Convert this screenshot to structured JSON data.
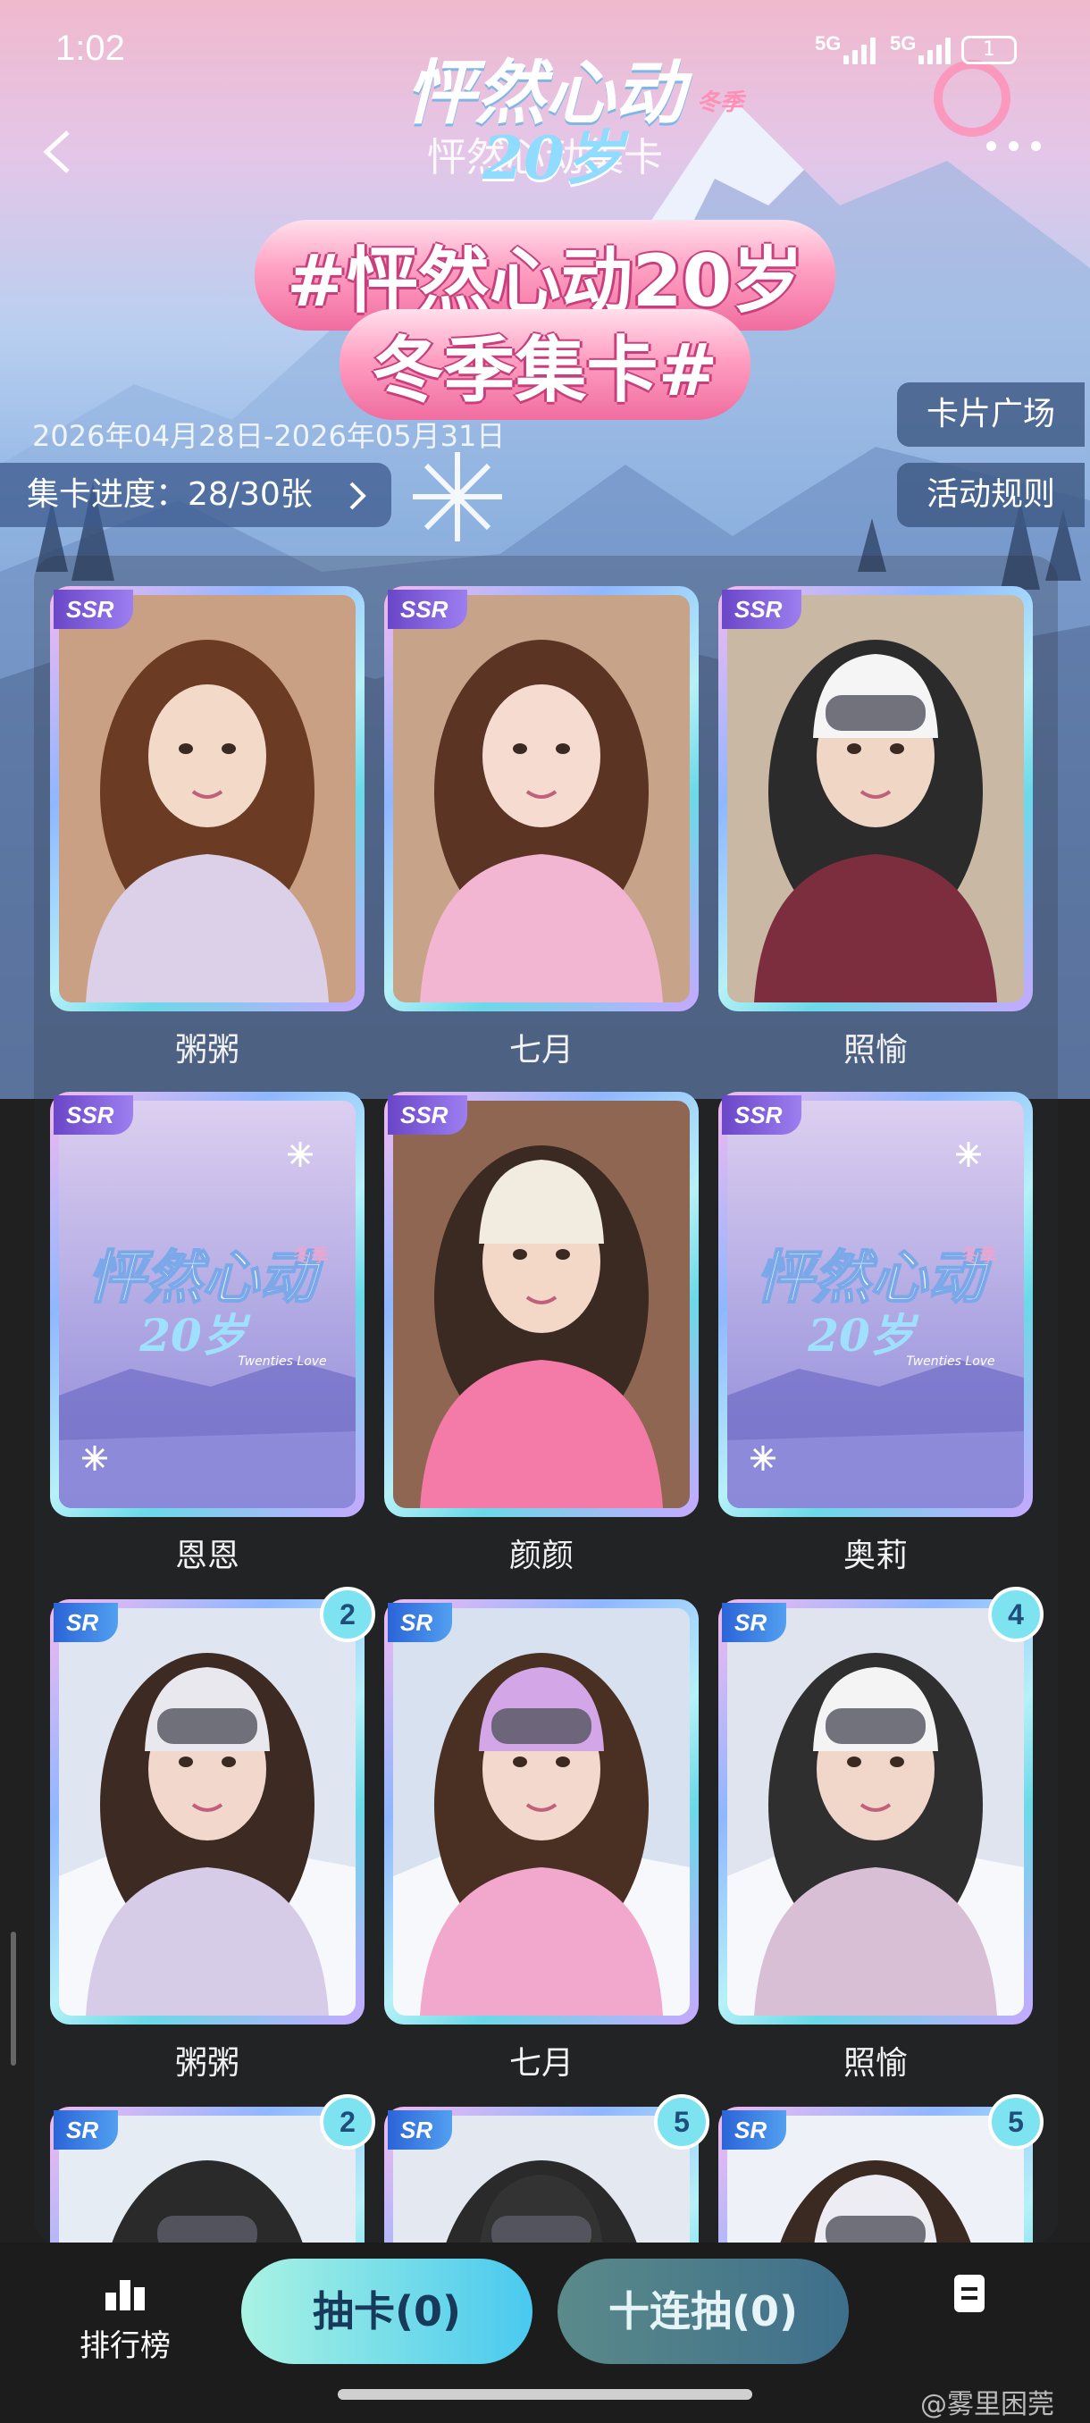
{
  "status_bar": {
    "time": "1:02",
    "signal_1": "5G",
    "signal_2": "5G",
    "battery": "1"
  },
  "header": {
    "title": "怦然心动集卡",
    "logo_main": "怦然心动",
    "logo_sub": "20岁",
    "logo_tag": "冬季"
  },
  "banner": {
    "line1": "#怦然心动20岁",
    "line2": "冬季集卡#"
  },
  "date_range": "2026年04月28日-2026年05月31日",
  "progress": {
    "label": "集卡进度：28/30张",
    "collected": 28,
    "total": 30
  },
  "side_buttons": {
    "card_plaza": "卡片广场",
    "rules": "活动规则"
  },
  "cards": [
    {
      "rarity": "SSR",
      "name": "粥粥",
      "count": "",
      "style": "portrait",
      "tone": "warm"
    },
    {
      "rarity": "SSR",
      "name": "七月",
      "count": "",
      "style": "portrait",
      "tone": "pink"
    },
    {
      "rarity": "SSR",
      "name": "照愉",
      "count": "",
      "style": "portrait",
      "tone": "helmet"
    },
    {
      "rarity": "SSR",
      "name": "恩恩",
      "count": "",
      "style": "locked",
      "tone": "locked"
    },
    {
      "rarity": "SSR",
      "name": "颜颜",
      "count": "",
      "style": "portrait",
      "tone": "beanie"
    },
    {
      "rarity": "SSR",
      "name": "奥莉",
      "count": "",
      "style": "locked",
      "tone": "locked"
    },
    {
      "rarity": "SR",
      "name": "粥粥",
      "count": "2",
      "style": "snow",
      "tone": "lilac"
    },
    {
      "rarity": "SR",
      "name": "七月",
      "count": "",
      "style": "snow",
      "tone": "pinksnow"
    },
    {
      "rarity": "SR",
      "name": "照愉",
      "count": "4",
      "style": "snow",
      "tone": "wave"
    },
    {
      "rarity": "SR",
      "name": "",
      "count": "2",
      "style": "snow",
      "tone": "dark"
    },
    {
      "rarity": "SR",
      "name": "",
      "count": "5",
      "style": "snow",
      "tone": "helmet2"
    },
    {
      "rarity": "SR",
      "name": "",
      "count": "5",
      "style": "snow",
      "tone": "white"
    }
  ],
  "locked_card": {
    "logo": "怦然心动",
    "logo_sub": "20岁",
    "small": "冬季",
    "eng": "Twenties Love"
  },
  "bottom_bar": {
    "rank_label": "排行榜",
    "draw_one": "抽卡(0)",
    "draw_ten": "十连抽(0)"
  },
  "watermark": "@雾里困莞"
}
